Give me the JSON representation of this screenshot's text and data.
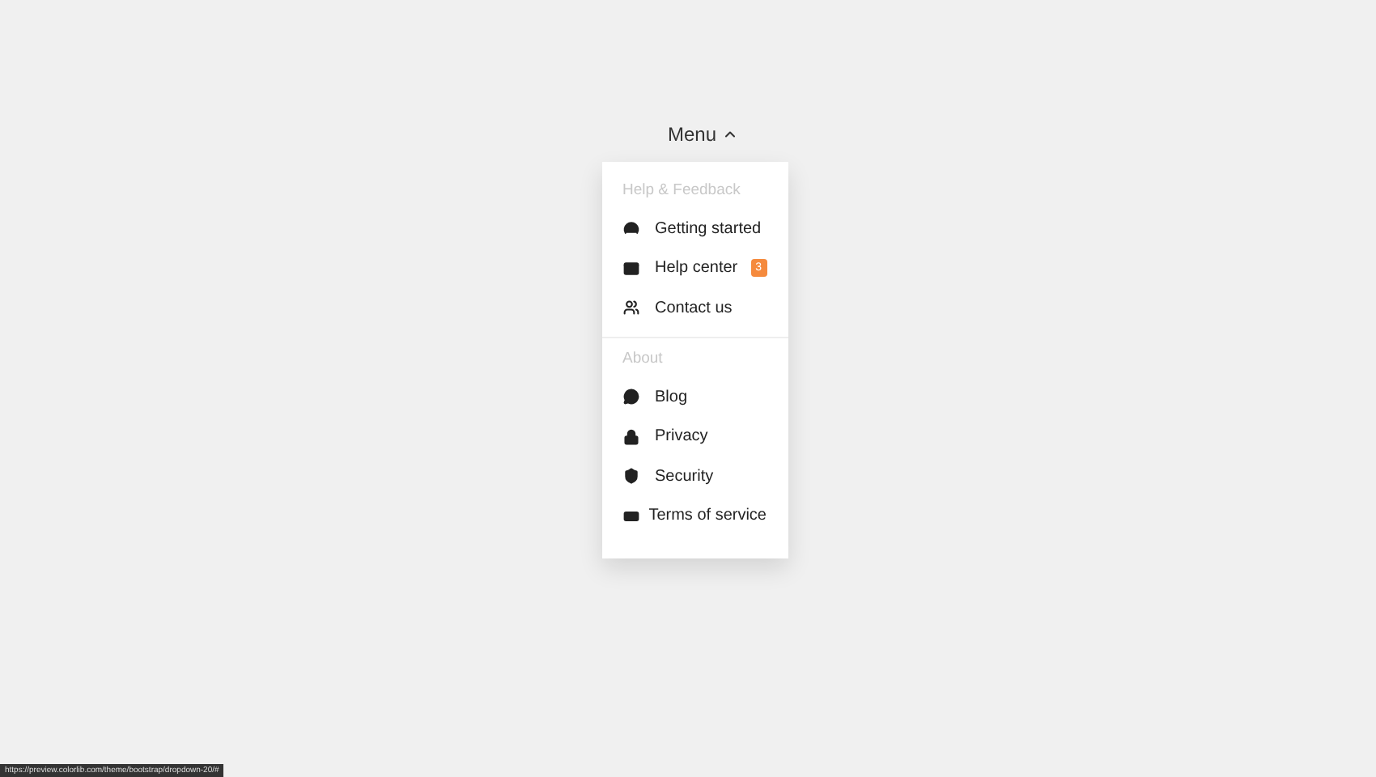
{
  "menu_button": {
    "label": "Menu",
    "expanded": true
  },
  "dropdown": {
    "sections": [
      {
        "heading": "Help & Feedback",
        "items": [
          {
            "label": "Getting started"
          },
          {
            "label": "Help center",
            "badge": "3"
          },
          {
            "label": "Contact us"
          }
        ]
      },
      {
        "heading": "About",
        "items": [
          {
            "label": "Blog"
          },
          {
            "label": "Privacy"
          },
          {
            "label": "Security"
          },
          {
            "label": "Terms of service"
          }
        ]
      }
    ]
  },
  "status_bar": {
    "url": "https://preview.colorlib.com/theme/bootstrap/dropdown-20/#"
  }
}
